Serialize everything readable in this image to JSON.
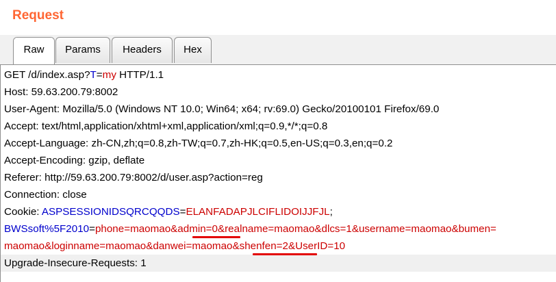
{
  "panel": {
    "title": "Request"
  },
  "tabs": [
    {
      "label": "Raw",
      "active": true
    },
    {
      "label": "Params",
      "active": false
    },
    {
      "label": "Headers",
      "active": false
    },
    {
      "label": "Hex",
      "active": false
    }
  ],
  "request": {
    "line1": {
      "method_path": "GET /d/index.asp?",
      "param_name": "T",
      "eq": "=",
      "param_value": "my",
      "protocol": " HTTP/1.1"
    },
    "host": "Host: 59.63.200.79:8002",
    "user_agent": "User-Agent: Mozilla/5.0 (Windows NT 10.0; Win64; x64; rv:69.0) Gecko/20100101 Firefox/69.0",
    "accept": "Accept: text/html,application/xhtml+xml,application/xml;q=0.9,*/*;q=0.8",
    "accept_language": "Accept-Language: zh-CN,zh;q=0.8,zh-TW;q=0.7,zh-HK;q=0.5,en-US;q=0.3,en;q=0.2",
    "accept_encoding": "Accept-Encoding: gzip, deflate",
    "referer": "Referer: http://59.63.200.79:8002/d/user.asp?action=reg",
    "connection": "Connection: close",
    "cookie": {
      "label": "Cookie: ",
      "c1_name": "ASPSESSIONIDSQRCQQDS",
      "c1_eq": "=",
      "c1_value": "ELANFADAPJLCIFLIDOIJJFJL",
      "sep": ";",
      "c2_name": "BWSsoft%5F2010",
      "c2_eq": "=",
      "c2_value_a": "phone=maomao&",
      "c2_value_admin": "admin=0",
      "c2_value_b": "&realname=maomao&dlcs=1&username=maomao&bumen=",
      "c2_value_c": "maomao&loginname=maomao&danwei=maomao&",
      "c2_value_shenfen": "shenfen=2",
      "c2_value_d": "&UserID=10"
    },
    "upgrade": "Upgrade-Insecure-Requests: 1"
  },
  "colors": {
    "title": "#ff6633",
    "param_name": "#0000cc",
    "param_value": "#cc0000",
    "underline": "#e30000"
  }
}
